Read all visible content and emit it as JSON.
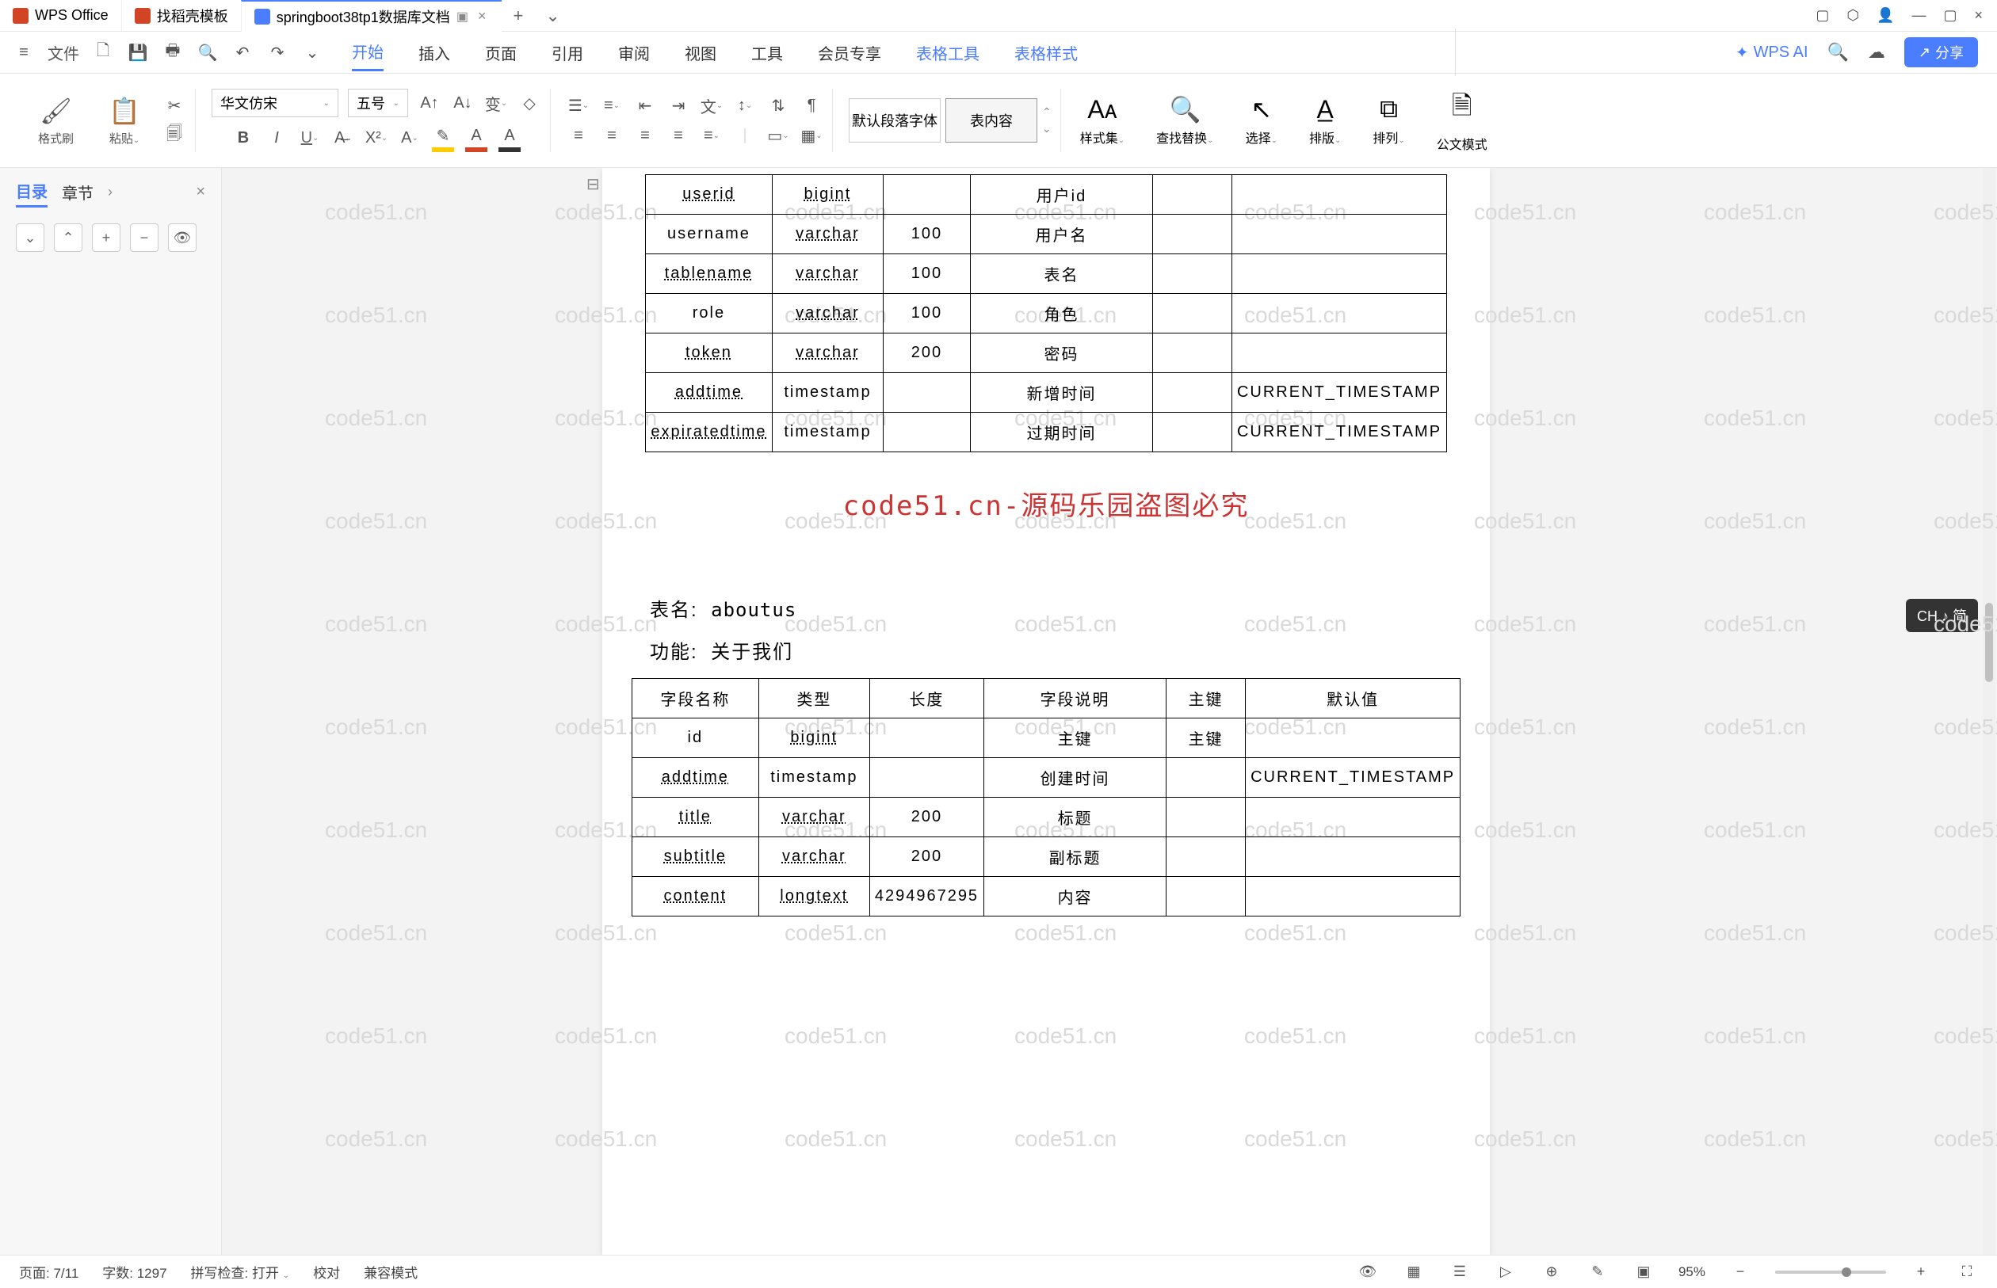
{
  "titlebar": {
    "app_name": "WPS Office",
    "tab1": "找稻壳模板",
    "tab2": "springboot38tp1数据库文档",
    "add": "+"
  },
  "menu": {
    "left_icons": [
      "≡",
      "文件",
      "📄",
      "💾",
      "↶",
      "↷",
      "⌄"
    ],
    "file_label": "文件",
    "tabs": [
      "开始",
      "插入",
      "页面",
      "引用",
      "审阅",
      "视图",
      "工具",
      "会员专享",
      "表格工具",
      "表格样式"
    ],
    "wps_ai": "WPS AI",
    "share": "分享"
  },
  "ribbon": {
    "format_brush": "格式刷",
    "paste": "粘贴",
    "font_name": "华文仿宋",
    "font_size": "五号",
    "para_default": "默认段落字体",
    "table_content": "表内容",
    "style_set": "样式集",
    "find_replace": "查找替换",
    "select": "选择",
    "layout": "排版",
    "arrange": "排列",
    "official_mode": "公文模式"
  },
  "sidebar": {
    "tab_toc": "目录",
    "tab_chapter": "章节"
  },
  "doc": {
    "table1": {
      "rows": [
        {
          "f": "userid",
          "t": "bigint",
          "l": "",
          "d": "用户id",
          "p": "",
          "def": ""
        },
        {
          "f": "username",
          "t": "varchar",
          "l": "100",
          "d": "用户名",
          "p": "",
          "def": ""
        },
        {
          "f": "tablename",
          "t": "varchar",
          "l": "100",
          "d": "表名",
          "p": "",
          "def": ""
        },
        {
          "f": "role",
          "t": "varchar",
          "l": "100",
          "d": "角色",
          "p": "",
          "def": ""
        },
        {
          "f": "token",
          "t": "varchar",
          "l": "200",
          "d": "密码",
          "p": "",
          "def": ""
        },
        {
          "f": "addtime",
          "t": "timestamp",
          "l": "",
          "d": "新增时间",
          "p": "",
          "def": "CURRENT_TIMESTAMP"
        },
        {
          "f": "expiratedtime",
          "t": "timestamp",
          "l": "",
          "d": "过期时间",
          "p": "",
          "def": "CURRENT_TIMESTAMP"
        }
      ]
    },
    "watermark": "code51.cn-源码乐园盗图必究",
    "table_name_label": "表名:",
    "table_name_value": "aboutus",
    "func_label": "功能:",
    "func_value": "关于我们",
    "table2": {
      "headers": [
        "字段名称",
        "类型",
        "长度",
        "字段说明",
        "主键",
        "默认值"
      ],
      "rows": [
        {
          "f": "id",
          "t": "bigint",
          "l": "",
          "d": "主键",
          "p": "主键",
          "def": ""
        },
        {
          "f": "addtime",
          "t": "timestamp",
          "l": "",
          "d": "创建时间",
          "p": "",
          "def": "CURRENT_TIMESTAMP"
        },
        {
          "f": "title",
          "t": "varchar",
          "l": "200",
          "d": "标题",
          "p": "",
          "def": ""
        },
        {
          "f": "subtitle",
          "t": "varchar",
          "l": "200",
          "d": "副标题",
          "p": "",
          "def": ""
        },
        {
          "f": "content",
          "t": "longtext",
          "l": "4294967295",
          "d": "内容",
          "p": "",
          "def": ""
        }
      ]
    }
  },
  "status": {
    "page": "页面: 7/11",
    "words": "字数: 1297",
    "spell": "拼写检查: 打开",
    "proof": "校对",
    "compat": "兼容模式",
    "zoom": "95%"
  },
  "ime": "CH ♪ 简",
  "wm_text": "code51.cn"
}
